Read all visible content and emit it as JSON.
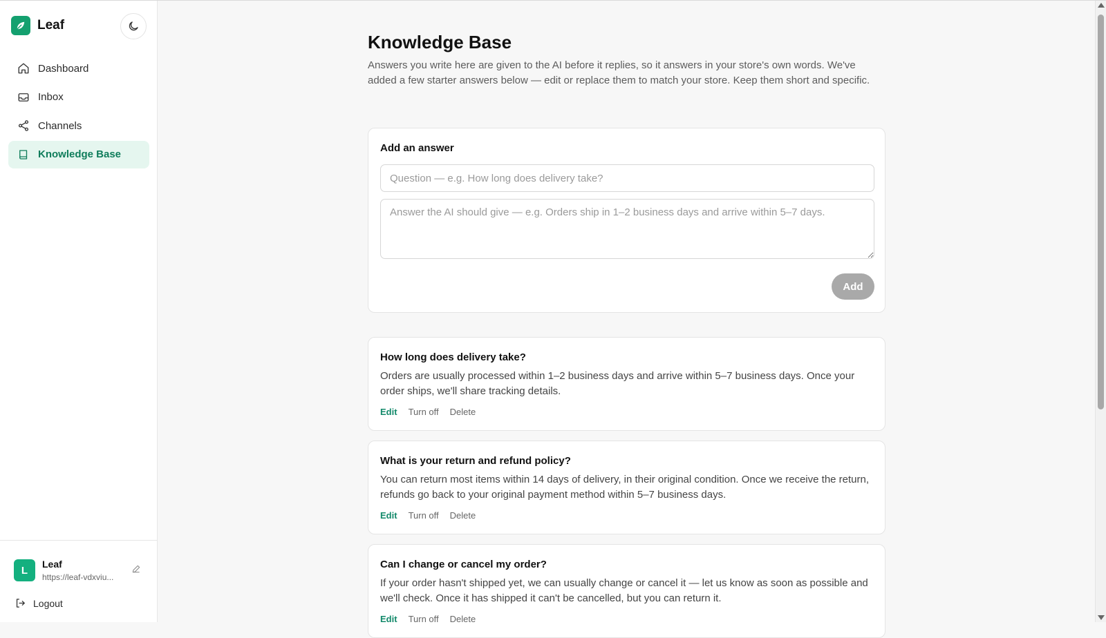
{
  "brand": {
    "name": "Leaf",
    "accent": "#14a06f"
  },
  "sidebar": {
    "items": [
      {
        "label": "Dashboard",
        "icon": "home-icon",
        "active": false
      },
      {
        "label": "Inbox",
        "icon": "inbox-icon",
        "active": false
      },
      {
        "label": "Channels",
        "icon": "share-icon",
        "active": false
      },
      {
        "label": "Knowledge Base",
        "icon": "book-icon",
        "active": true
      }
    ],
    "store": {
      "initial": "L",
      "name": "Leaf",
      "url": "https://leaf-vdxviu..."
    },
    "logout_label": "Logout"
  },
  "page": {
    "title": "Knowledge Base",
    "description": "Answers you write here are given to the AI before it replies, so it answers in your store's own words. We've added a few starter answers below — edit or replace them to match your store. Keep them short and specific."
  },
  "add_form": {
    "title": "Add an answer",
    "question_placeholder": "Question — e.g. How long does delivery take?",
    "answer_placeholder": "Answer the AI should give — e.g. Orders ship in 1–2 business days and arrive within 5–7 days.",
    "add_label": "Add"
  },
  "answers": [
    {
      "question": "How long does delivery take?",
      "answer": "Orders are usually processed within 1–2 business days and arrive within 5–7 business days. Once your order ships, we'll share tracking details.",
      "edit_label": "Edit",
      "toggle_label": "Turn off",
      "delete_label": "Delete"
    },
    {
      "question": "What is your return and refund policy?",
      "answer": "You can return most items within 14 days of delivery, in their original condition. Once we receive the return, refunds go back to your original payment method within 5–7 business days.",
      "edit_label": "Edit",
      "toggle_label": "Turn off",
      "delete_label": "Delete"
    },
    {
      "question": "Can I change or cancel my order?",
      "answer": "If your order hasn't shipped yet, we can usually change or cancel it — let us know as soon as possible and we'll check. Once it has shipped it can't be cancelled, but you can return it.",
      "edit_label": "Edit",
      "toggle_label": "Turn off",
      "delete_label": "Delete"
    }
  ]
}
